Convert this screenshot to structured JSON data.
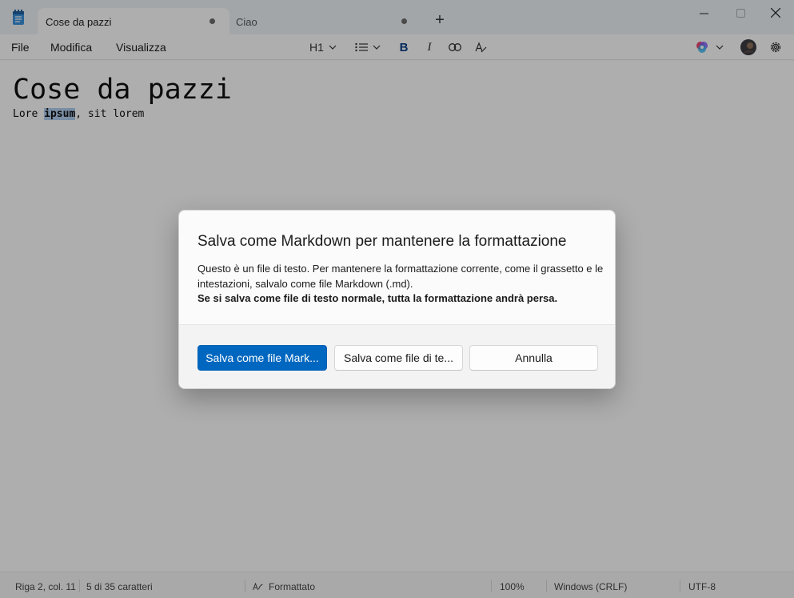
{
  "window": {
    "tabs": [
      {
        "label": "Cose da pazzi",
        "modified": true
      },
      {
        "label": "Ciao",
        "modified": true
      }
    ],
    "new_tab_symbol": "+"
  },
  "menu": {
    "items": [
      "File",
      "Modifica",
      "Visualizza"
    ]
  },
  "toolbar": {
    "heading_level": "H1",
    "bold_symbol": "B",
    "italic_symbol": "I"
  },
  "document": {
    "heading": "Cose da pazzi",
    "para_before": "Lore ",
    "para_selected": "ipsum",
    "para_after": ", sit lorem"
  },
  "dialog": {
    "title": "Salva come Markdown per mantenere la formattazione",
    "body": "Questo è un file di testo. Per mantenere la formattazione corrente, come il grassetto e le intestazioni, salvalo come file Markdown (.md).",
    "warning": "Se si salva come file di testo normale, tutta la formattazione andrà persa.",
    "buttons": {
      "save_markdown": "Salva come file Mark...",
      "save_text": "Salva come file di te...",
      "cancel": "Annulla"
    }
  },
  "status": {
    "position": "Riga 2, col. 11",
    "selection": "5 di 35 caratteri",
    "format": "Formattato",
    "zoom": "100%",
    "line_ending": "Windows (CRLF)",
    "encoding": "UTF-8"
  },
  "colors": {
    "accent": "#0067c0",
    "selection": "#aecbeb"
  }
}
